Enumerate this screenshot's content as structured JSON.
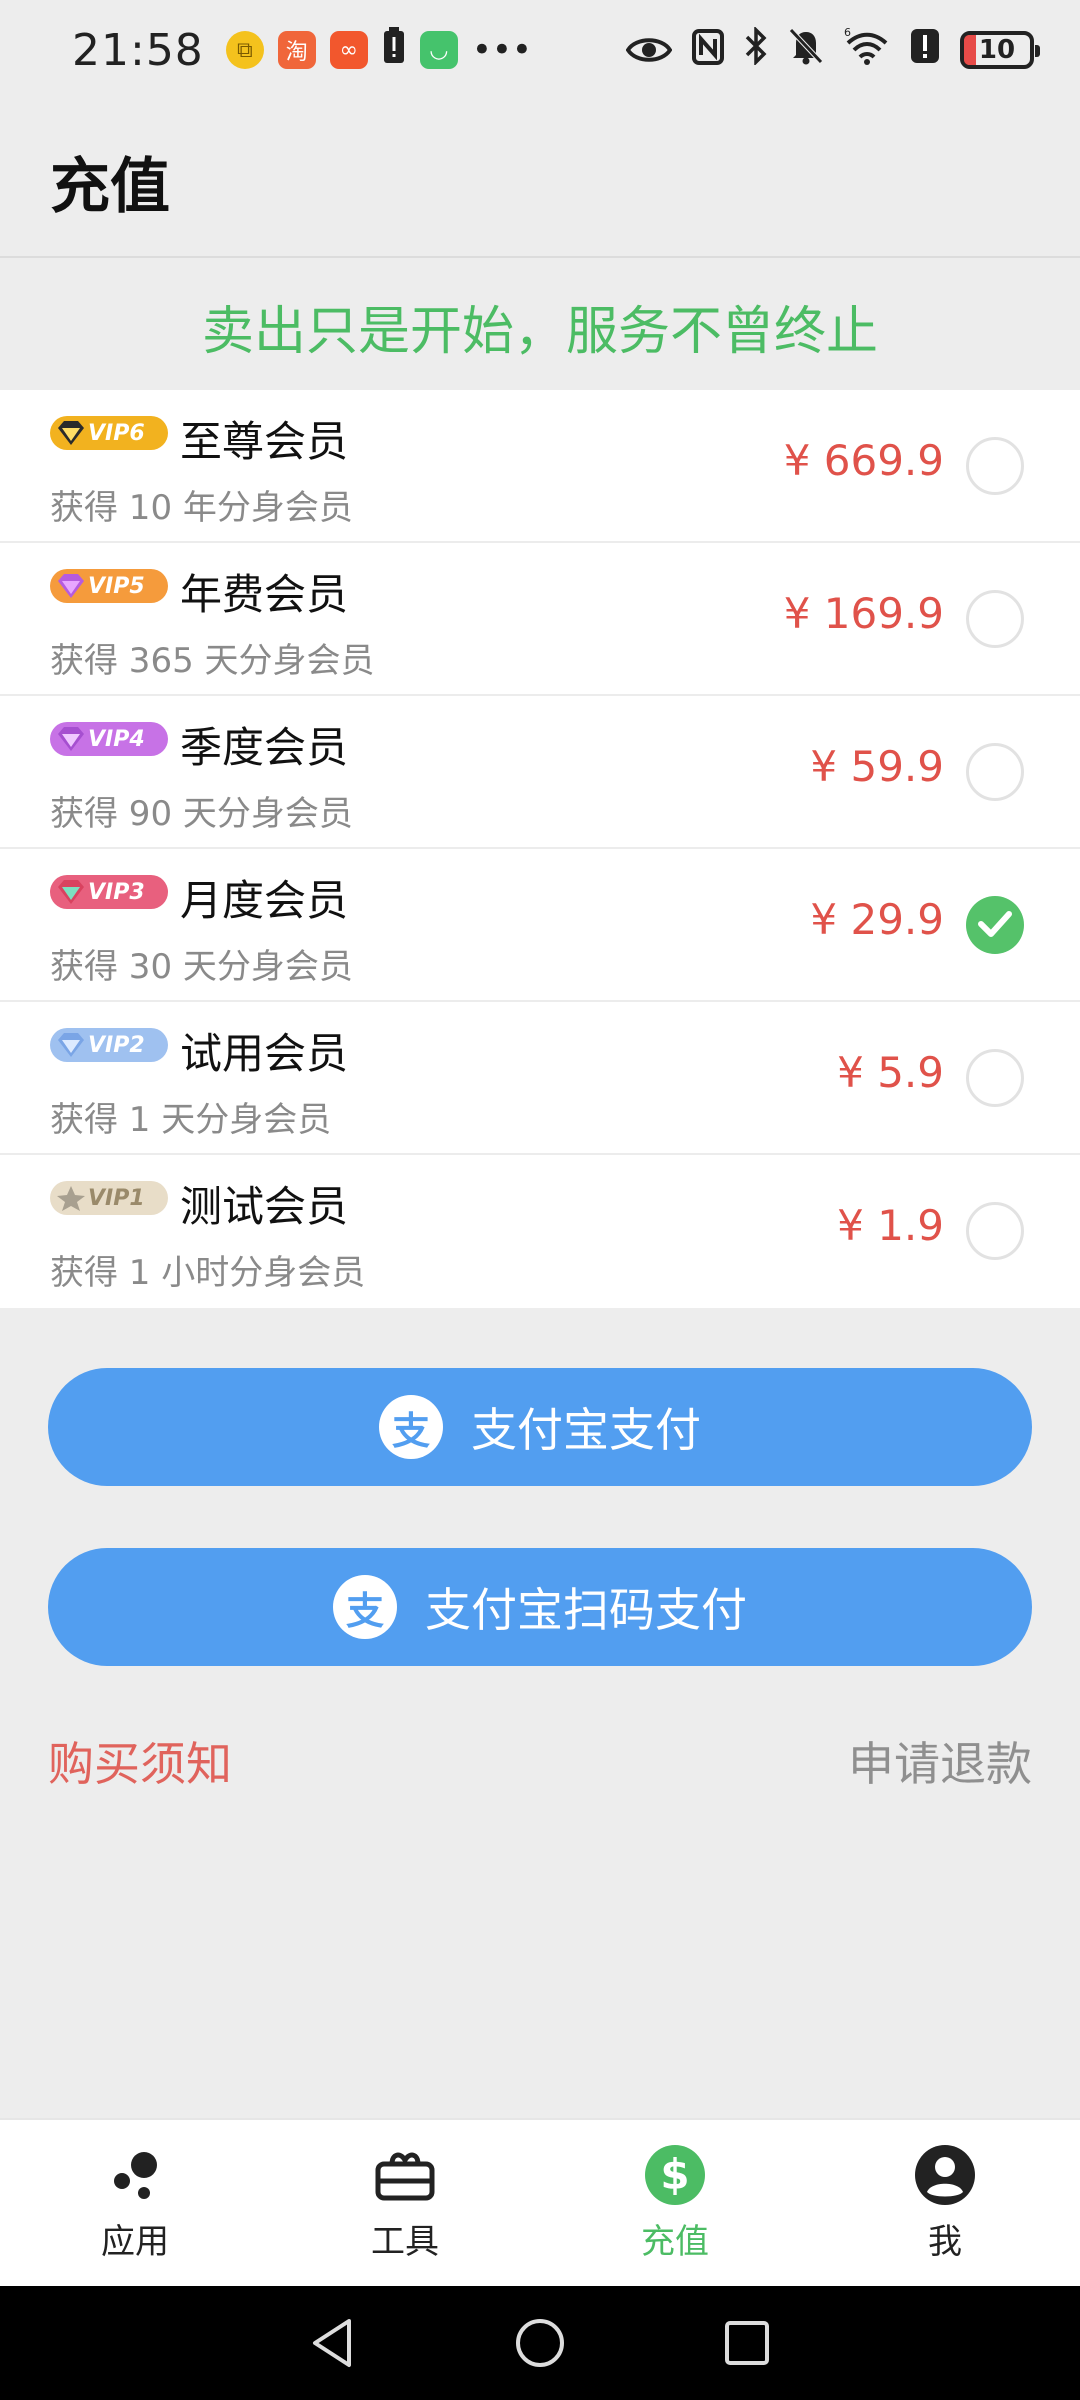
{
  "status_bar": {
    "time": "21:58",
    "battery": "10",
    "left_icons": [
      "copy-app-icon",
      "taobao-icon",
      "app-grid-icon",
      "battery-alert-icon",
      "mi-home-icon",
      "more-dots-icon"
    ],
    "right_icons": [
      "eye-icon",
      "nfc-icon",
      "bluetooth-icon",
      "mute-bell-icon",
      "wifi-icon",
      "alert-icon",
      "battery-icon"
    ]
  },
  "header": {
    "title": "充值"
  },
  "slogan": "卖出只是开始，服务不曾终止",
  "plans": [
    {
      "badge": "VIP6",
      "name": "至尊会员",
      "desc": "获得 10 年分身会员",
      "price": "¥ 669.9",
      "selected": false,
      "badge_color": "#f2b21f"
    },
    {
      "badge": "VIP5",
      "name": "年费会员",
      "desc": "获得 365 天分身会员",
      "price": "¥ 169.9",
      "selected": false,
      "badge_color": "#f59b3c"
    },
    {
      "badge": "VIP4",
      "name": "季度会员",
      "desc": "获得 90 天分身会员",
      "price": "¥ 59.9",
      "selected": false,
      "badge_color": "#c772e6"
    },
    {
      "badge": "VIP3",
      "name": "月度会员",
      "desc": "获得 30 天分身会员",
      "price": "¥ 29.9",
      "selected": true,
      "badge_color": "#e8607e"
    },
    {
      "badge": "VIP2",
      "name": "试用会员",
      "desc": "获得 1 天分身会员",
      "price": "¥ 5.9",
      "selected": false,
      "badge_color": "#9fc1f0"
    },
    {
      "badge": "VIP1",
      "name": "测试会员",
      "desc": "获得 1 小时分身会员",
      "price": "¥ 1.9",
      "selected": false,
      "badge_color": "#e8ddc8"
    }
  ],
  "pay": {
    "alipay_label": "支付宝支付",
    "alipay_scan_label": "支付宝扫码支付",
    "alipay_icon_char": "支"
  },
  "links": {
    "notice": "购买须知",
    "refund": "申请退款"
  },
  "bottom_nav": [
    {
      "label": "应用",
      "icon": "apps-dots-icon",
      "active": false
    },
    {
      "label": "工具",
      "icon": "toolbox-icon",
      "active": false
    },
    {
      "label": "充值",
      "icon": "dollar-circle-icon",
      "active": true
    },
    {
      "label": "我",
      "icon": "account-circle-icon",
      "active": false
    }
  ],
  "colors": {
    "accent_green": "#4cbc64",
    "price_red": "#e0524a",
    "button_blue": "#529ef0",
    "notice_red": "#e0635c"
  }
}
